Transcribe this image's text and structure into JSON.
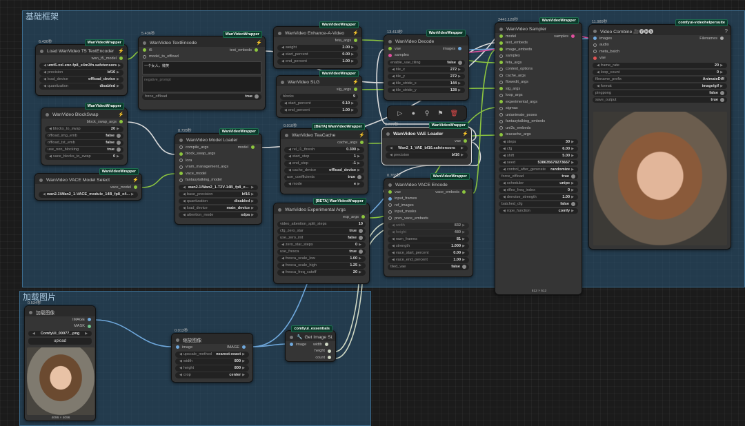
{
  "groups": {
    "base": "基础框架",
    "load": "加载图片"
  },
  "badges": {
    "wvw": "WanVideoWrapper",
    "beta_wvw": "[BETA] WanVideoWrapper",
    "vhs": "comfyui-videohelpersuite",
    "essentials": "comfyui_essentials"
  },
  "t5": {
    "time": "6.430秒",
    "title": "Load WanVideo T5 TextEncoder",
    "out": "wan_t5_model",
    "model": "umt5-xxl-enc-fp8_e4m3fn.safetensors",
    "precision_l": "precision",
    "precision_v": "bf16",
    "load_l": "load_device",
    "load_v": "offload_device",
    "quant_l": "quantization",
    "quant_v": "disabled"
  },
  "te": {
    "time": "5.436秒",
    "title": "WanVideo TextEncode",
    "in1": "t5",
    "in2": "model_to_offload",
    "out": "text_embeds",
    "pos": "一个女人，微笑",
    "neg": "negative_prompt",
    "force_l": "force_offload",
    "force_v": "true"
  },
  "ea": {
    "title": "WanVideo Enhance-A-Video",
    "out": "feta_args",
    "w1l": "weight",
    "w1v": "2.00",
    "w2l": "start_percent",
    "w2v": "0.00",
    "w3l": "end_percent",
    "w3v": "1.00"
  },
  "slg": {
    "title": "WanVideo SLG",
    "out": "slg_args",
    "w1l": "blocks",
    "w1v": "9",
    "w2l": "start_percent",
    "w2v": "0.10",
    "w3l": "end_percent",
    "w3v": "1.00"
  },
  "bs": {
    "title": "WanVideo BlockSwap",
    "out": "block_swap_args",
    "w1l": "blocks_to_swap",
    "w1v": "20",
    "w2l": "offload_img_emb",
    "w2v": "false",
    "w3l": "offload_txt_emb",
    "w3v": "false",
    "w4l": "use_non_blocking",
    "w4v": "true",
    "w5l": "vace_blocks_to_swap",
    "w5v": "0"
  },
  "vms": {
    "title": "WanVideo VACE Model Select",
    "out": "vace_model",
    "model": "wan2.1\\Wan2_1-VACE_module_14B_fp8_e4..."
  },
  "ml": {
    "time": "8.728秒",
    "title": "WanVideo Model Loader",
    "out": "model",
    "in1": "compile_args",
    "in2": "block_swap_args",
    "in3": "lora",
    "in4": "vram_management_args",
    "in5": "vace_model",
    "in6": "fantasytalking_model",
    "model": "wan2.1\\Wan2_1-T2V-14B_fp8_e...",
    "w1l": "base_precision",
    "w1v": "bf16",
    "w2l": "quantization",
    "w2v": "disabled",
    "w3l": "load_device",
    "w3v": "main_device",
    "w4l": "attention_mode",
    "w4v": "sdpa"
  },
  "tc": {
    "time": "0.010秒",
    "title": "WanVideo TeaCache",
    "out": "cache_args",
    "w1l": "rel_l1_thresh",
    "w1v": "0.300",
    "w2l": "start_step",
    "w2v": "1",
    "w3l": "end_step",
    "w3v": "-1",
    "w4l": "cache_device",
    "w4v": "offload_device",
    "w5l": "use_coefficients",
    "w5v": "true",
    "w6l": "mode",
    "w6v": "e"
  },
  "exp": {
    "title": "WanVideo Experimental Args",
    "out": "exp_args",
    "w1l": "video_attention_split_steps",
    "w1v": "10",
    "w2l": "cfg_zero_star",
    "w2v": "true",
    "w3l": "use_zero_init",
    "w3v": "false",
    "w4l": "zero_star_steps",
    "w4v": "0",
    "w5l": "use_fresca",
    "w5v": "true",
    "w6l": "fresca_scale_low",
    "w6v": "1.00",
    "w7l": "fresca_scale_high",
    "w7v": "1.25",
    "w8l": "fresca_freq_cutoff",
    "w8v": "20"
  },
  "dec": {
    "time": "13.413秒",
    "title": "WanVideo Decode",
    "in1": "vae",
    "in2": "samples",
    "out": "images",
    "w1l": "enable_vae_tiling",
    "w1v": "false",
    "w2l": "tile_x",
    "w2v": "272",
    "w3l": "tile_y",
    "w3v": "272",
    "w4l": "tile_stride_x",
    "w4v": "144",
    "w5l": "tile_stride_y",
    "w5v": "128"
  },
  "vl": {
    "time": "0.777秒",
    "title": "WanVideo VAE Loader",
    "out": "vae",
    "model": "Wan2_1_VAE_bf16.safetensors",
    "w1l": "precision",
    "w1v": "bf16"
  },
  "ve": {
    "time": "0.765秒",
    "title": "WanVideo VACE Encode",
    "out": "vace_embeds",
    "in1": "vae",
    "in2": "input_frames",
    "in3": "ref_images",
    "in4": "input_masks",
    "in5": "prev_vace_embeds",
    "w1l": "width",
    "w1v": "832",
    "w2l": "height",
    "w2v": "480",
    "w3l": "num_frames",
    "w3v": "81",
    "w4l": "strength",
    "w4v": "1.000",
    "w5l": "vace_start_percent",
    "w5v": "0.00",
    "w6l": "vace_end_percent",
    "w6v": "1.00",
    "w7l": "tiled_vae",
    "w7v": "false",
    "caption": "512 × 512"
  },
  "samp": {
    "time": "2441.120秒",
    "title": "WanVideo Sampler",
    "out": "samples",
    "ins": [
      "model",
      "text_embeds",
      "image_embeds",
      "samples",
      "feta_args",
      "context_options",
      "cache_args",
      "flowedit_args",
      "slg_args",
      "loop_args",
      "experimental_args",
      "sigmas",
      "unianimate_poses",
      "fantasytalking_embeds",
      "uni3c_embeds",
      "teacache_args"
    ],
    "w": [
      [
        "steps",
        "30"
      ],
      [
        "cfg",
        "6.00"
      ],
      [
        "shift",
        "5.00"
      ],
      [
        "seed",
        "538635679273667"
      ],
      [
        "control_after_generate",
        "randomize"
      ],
      [
        "force_offload",
        "true"
      ],
      [
        "scheduler",
        "unipc"
      ],
      [
        "riflex_freq_index",
        "0"
      ],
      [
        "denoise_strength",
        "1.00"
      ],
      [
        "batched_cfg",
        "false"
      ],
      [
        "rope_function",
        "comfy"
      ]
    ],
    "caption": "512 × 512"
  },
  "vc": {
    "time": "11.989秒",
    "title": "Video Combine 🎥🅥🅗🅢",
    "ins": [
      "images",
      "audio",
      "meta_batch",
      "vae"
    ],
    "out": "Filenames",
    "w": [
      [
        "frame_rate",
        "20"
      ],
      [
        "loop_count",
        "0"
      ],
      [
        "filename_prefix",
        "AnimateDiff"
      ],
      [
        "format",
        "image/gif"
      ],
      [
        "pingpong",
        "false"
      ],
      [
        "save_output",
        "true"
      ]
    ]
  },
  "li": {
    "time": "0.534秒",
    "title": "加载图像",
    "out1": "IMAGE",
    "out2": "MASK",
    "file": "ComfyUI_00077_.png",
    "upload": "upload",
    "caption": "4096 × 4096"
  },
  "scale": {
    "time": "0.012秒",
    "title": "缩放图像",
    "in": "image",
    "out": "IMAGE",
    "w1l": "upscale_method",
    "w1v": "nearest-exact",
    "w2l": "width",
    "w2v": "800",
    "w3l": "height",
    "w3v": "800",
    "w4l": "crop",
    "w4v": "center"
  },
  "gis": {
    "title": "Get Image Size",
    "in": "image",
    "o1": "width",
    "o2": "height",
    "o3": "count"
  },
  "colors": {
    "group": "#295576",
    "node": "#353535",
    "link_green": "#8dc63f",
    "link_white": "#dcdcdc",
    "link_blue": "#6fa8dc",
    "link_pink": "#e04f9d"
  }
}
